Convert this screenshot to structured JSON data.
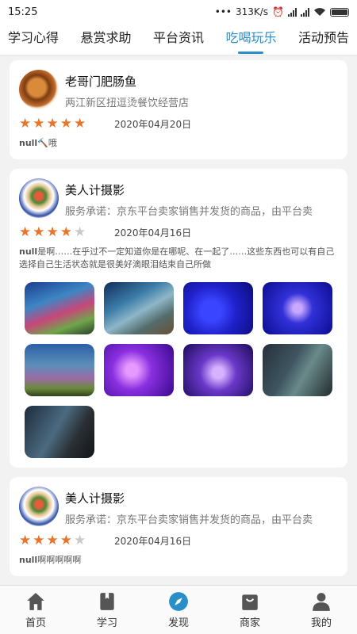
{
  "status": {
    "time": "15:25",
    "speed": "313K/s"
  },
  "tabs": [
    {
      "label": "学习心得"
    },
    {
      "label": "悬赏求助"
    },
    {
      "label": "平台资讯"
    },
    {
      "label": "吃喝玩乐",
      "active": true
    },
    {
      "label": "活动预告"
    }
  ],
  "posts": [
    {
      "name": "老哥门肥肠鱼",
      "subtitle": "两江新区扭逗烫餐饮经营店",
      "rating": 5,
      "date": "2020年04月20日",
      "comment_user": "null",
      "comment_text": "🔨哦"
    },
    {
      "name": "美人计摄影",
      "subtitle": "服务承诺：京东平台卖家销售并发货的商品，由平台卖",
      "rating": 4,
      "date": "2020年04月16日",
      "comment_user": "null",
      "comment_text": "是啊……在乎过不一定知道你是在哪呢、在一起了……这些东西也可以有自己选择自己生活状态就是很美好滴眼泪结束自己所做",
      "photo_count": 9
    },
    {
      "name": "美人计摄影",
      "subtitle": "服务承诺：京东平台卖家销售并发货的商品，由平台卖",
      "rating": 4,
      "date": "2020年04月16日",
      "comment_user": "null",
      "comment_text": "啊啊啊啊啊"
    }
  ],
  "nav": [
    {
      "label": "首页",
      "icon": "home-icon"
    },
    {
      "label": "学习",
      "icon": "book-icon"
    },
    {
      "label": "发现",
      "icon": "compass-icon",
      "active": true
    },
    {
      "label": "商家",
      "icon": "shop-bag-icon"
    },
    {
      "label": "我的",
      "icon": "user-icon"
    }
  ],
  "colors": {
    "accent": "#2a8fc6",
    "star": "#e8752b",
    "star_off": "#c9c9c9"
  }
}
